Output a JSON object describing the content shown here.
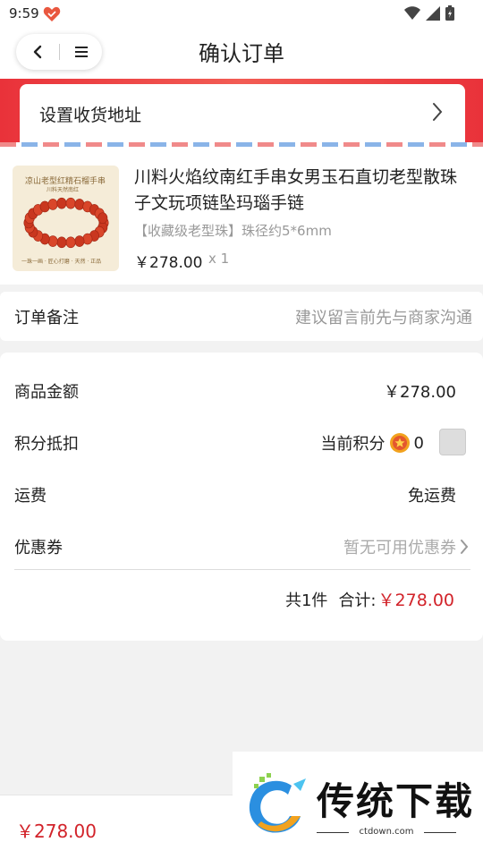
{
  "status_bar": {
    "time": "9:59"
  },
  "nav": {
    "title": "确认订单"
  },
  "address": {
    "label": "设置收货地址"
  },
  "product": {
    "name": "川料火焰纹南红手串女男玉石直切老型散珠子文玩项链坠玛瑙手链",
    "spec": "【收藏级老型珠】珠径约5*6mm",
    "price": "￥278.00",
    "qty": "x 1",
    "image_text": {
      "title": "凉山老型红精石榴手串",
      "subtitle": "川料天然南红",
      "footer": "一珠一画 · 匠心打磨 · 天然 · 正品"
    }
  },
  "remark": {
    "label": "订单备注",
    "placeholder": "建议留言前先与商家沟通"
  },
  "summary": {
    "goods_label": "商品金额",
    "goods_value": "￥278.00",
    "points_label": "积分抵扣",
    "points_current_label": "当前积分",
    "points_value": "0",
    "shipping_label": "运费",
    "shipping_value": "免运费",
    "coupon_label": "优惠券",
    "coupon_value": "暂无可用优惠券",
    "count_text": "共1件",
    "total_label": "合计:",
    "total_value": "￥278.00"
  },
  "bottom": {
    "price": "￥278.00"
  },
  "watermark": {
    "text": "传统下载",
    "url": "ctdown.com"
  },
  "colors": {
    "accent_red": "#d2232a",
    "banner_red": "#e9323a"
  }
}
